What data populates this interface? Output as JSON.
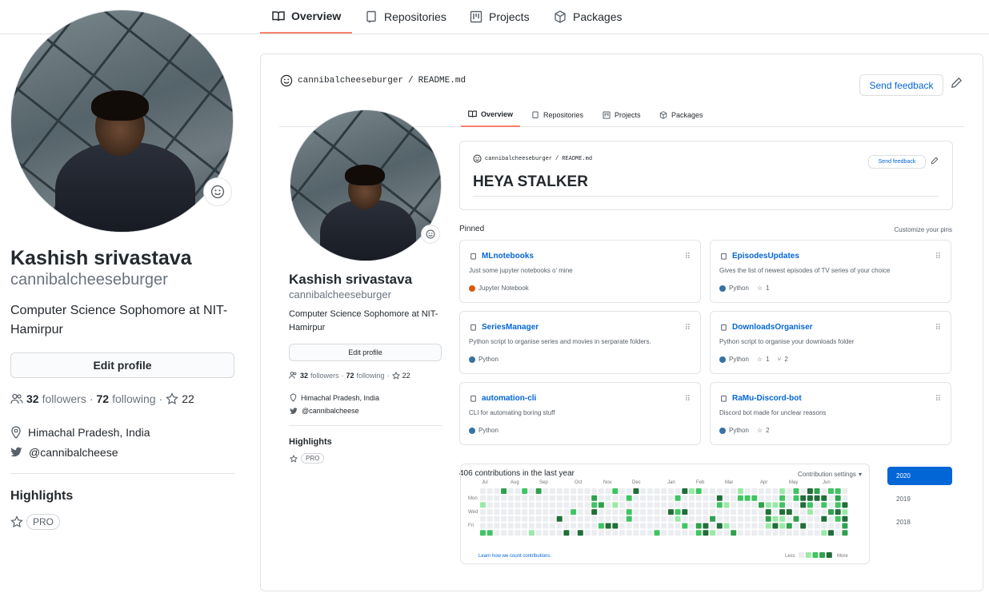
{
  "nav": {
    "tabs": [
      {
        "label": "Overview",
        "icon": "book-icon"
      },
      {
        "label": "Repositories",
        "icon": "repo-icon"
      },
      {
        "label": "Projects",
        "icon": "project-icon"
      },
      {
        "label": "Packages",
        "icon": "package-icon"
      }
    ]
  },
  "profile": {
    "name": "Kashish srivastava",
    "login": "cannibalcheeseburger",
    "bio": "Computer Science Sophomore at NIT-Hamirpur",
    "edit_label": "Edit profile",
    "followers_count": "32",
    "followers_label": "followers",
    "separator": "·",
    "following_count": "72",
    "following_label": "following",
    "stars": "22",
    "location": "Himachal Pradesh, India",
    "twitter": "@cannibalcheese",
    "highlights_title": "Highlights",
    "pro_badge": "PRO"
  },
  "readme": {
    "owner": "cannibalcheeseburger",
    "slash": "/",
    "file": "README.md",
    "feedback_label": "Send feedback",
    "heading": "HEYA STALKER"
  },
  "pinned": {
    "title": "Pinned",
    "customize": "Customize your pins",
    "repos": [
      {
        "name": "MLnotebooks",
        "desc": "Just some jupyter notebooks o' mine",
        "lang": "Jupyter Notebook",
        "color": "#DA5B0B",
        "stars": "",
        "forks": ""
      },
      {
        "name": "EpisodesUpdates",
        "desc": "Gives the list of newest episodes of TV series of your choice",
        "lang": "Python",
        "color": "#3572A5",
        "stars": "1",
        "forks": ""
      },
      {
        "name": "SeriesManager",
        "desc": "Python script to organise series and movies in serparate folders.",
        "lang": "Python",
        "color": "#3572A5",
        "stars": "",
        "forks": ""
      },
      {
        "name": "DownloadsOrganiser",
        "desc": "Python script to organise your downloads folder",
        "lang": "Python",
        "color": "#3572A5",
        "stars": "1",
        "forks": "2"
      },
      {
        "name": "automation-cli",
        "desc": "CLI for automating boring stuff",
        "lang": "Python",
        "color": "#3572A5",
        "stars": "",
        "forks": ""
      },
      {
        "name": "RaMu-Discord-bot",
        "desc": "Discord bot made for unclear reasons",
        "lang": "Python",
        "color": "#3572A5",
        "stars": "2",
        "forks": ""
      }
    ]
  },
  "contributions": {
    "summary": "406 contributions in the last year",
    "settings": "Contribution settings",
    "months": [
      "Jul",
      "Aug",
      "Sep",
      "Oct",
      "Nov",
      "Dec",
      "Jan",
      "Feb",
      "Mar",
      "Apr",
      "May",
      "Jun"
    ],
    "days": [
      "Mon",
      "Wed",
      "Fri"
    ],
    "learn": "Learn how we count contributions.",
    "less": "Less",
    "more": "More",
    "years": [
      "2020",
      "2019",
      "2018"
    ],
    "colors": [
      "#ebedf0",
      "#9be9a8",
      "#40c463",
      "#30a14e",
      "#216e39"
    ]
  }
}
